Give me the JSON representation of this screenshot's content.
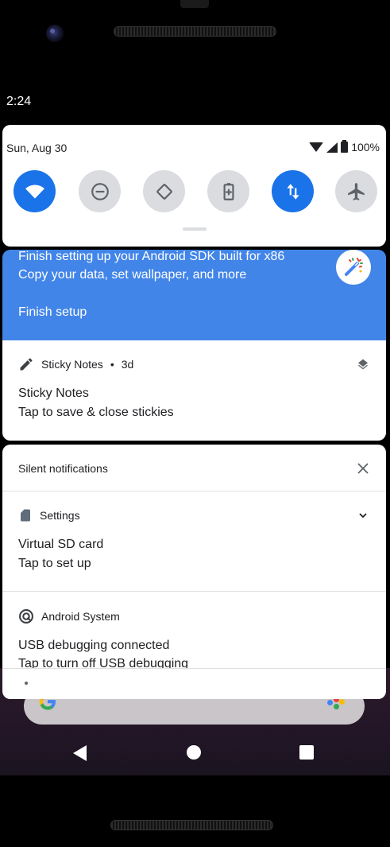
{
  "status_bar": {
    "time": "2:24"
  },
  "quick_settings": {
    "date": "Sun, Aug 30",
    "battery": "100%",
    "tiles": [
      {
        "name": "wifi",
        "icon": "wifi-icon",
        "active": true
      },
      {
        "name": "do-not-disturb",
        "icon": "do-not-disturb-icon",
        "active": false
      },
      {
        "name": "auto-rotate",
        "icon": "auto-rotate-icon",
        "active": false
      },
      {
        "name": "battery-saver",
        "icon": "battery-saver-icon",
        "active": false
      },
      {
        "name": "mobile-data",
        "icon": "data-arrows-icon",
        "active": true
      },
      {
        "name": "airplane-mode",
        "icon": "airplane-icon",
        "active": false
      }
    ]
  },
  "setup_notification": {
    "title": "Finish setting up your Android SDK built for x86",
    "text": "Copy your data, set wallpaper, and more",
    "action": "Finish setup",
    "color": "#4285e8"
  },
  "sticky_notification": {
    "app": "Sticky Notes",
    "time": "3d",
    "title": "Sticky Notes",
    "text": "Tap to save & close stickies"
  },
  "silent": {
    "header": "Silent notifications",
    "items": [
      {
        "app": "Settings",
        "title": "Virtual SD card",
        "text": "Tap to set up"
      },
      {
        "app": "Android System",
        "title": "USB debugging connected",
        "text": "Tap to turn off USB debugging"
      }
    ]
  },
  "colors": {
    "accent": "#1a73e8",
    "tile_off": "#dadce0"
  }
}
